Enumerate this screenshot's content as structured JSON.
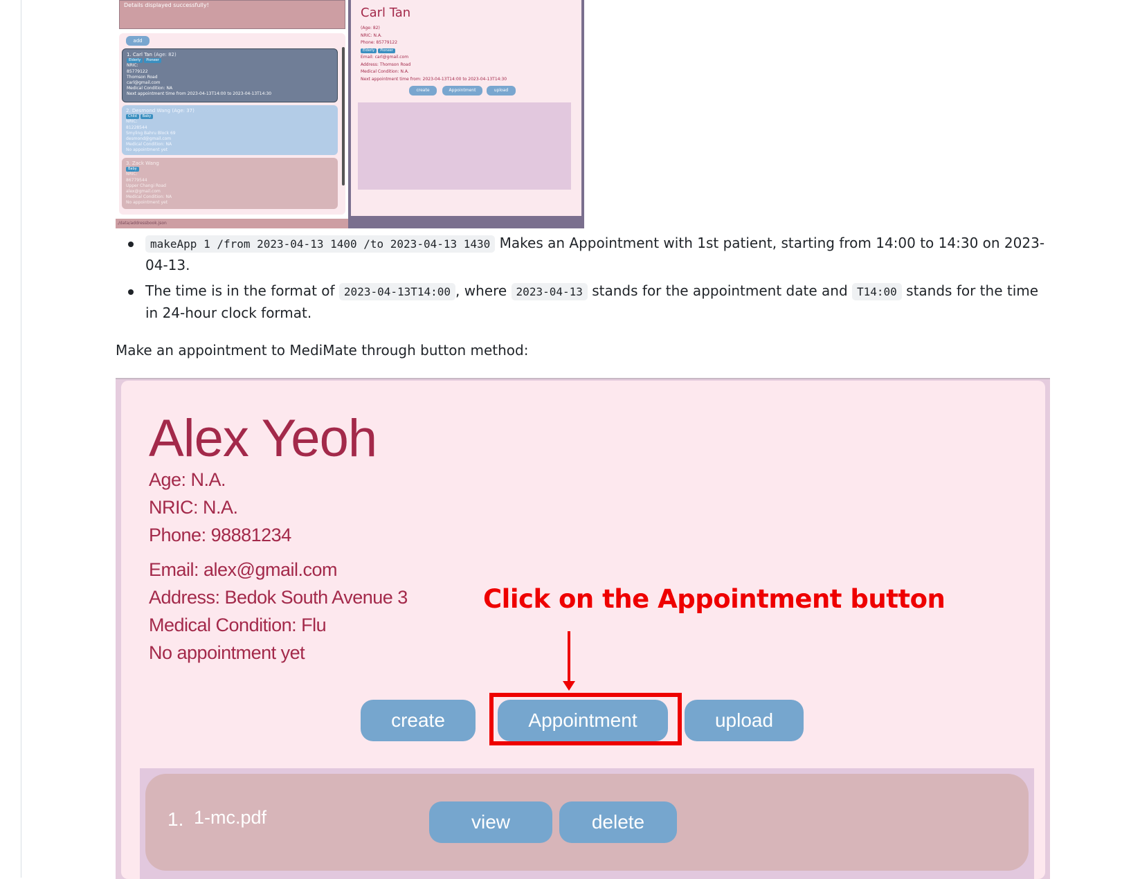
{
  "top_screenshot": {
    "result_text": "Details displayed successfully!",
    "add_label": "add",
    "cards": [
      {
        "index": "1.",
        "name": "Carl Tan",
        "age": "(Age: 82)",
        "tags": [
          "Elderly",
          "Pioneer"
        ],
        "lines": [
          "NRIC:",
          "85779122",
          "Thomson Road",
          "carl@gmail.com",
          "Medical Condition: NA",
          "Next appointment time from 2023-04-13T14:00 to 2023-04-13T14:30"
        ]
      },
      {
        "index": "2.",
        "name": "Desmond Wang",
        "age": "(Age: 37)",
        "tags": [
          "Child",
          "Baby"
        ],
        "lines": [
          "NRIC:",
          "81228544",
          "Smyling Bahru Block 69",
          "desmond@gmail.com",
          "Medical Condition: NA",
          "No appointment yet"
        ]
      },
      {
        "index": "3.",
        "name": "Zack Wang",
        "age": "",
        "tags": [
          "Baby"
        ],
        "lines": [
          "NRIC:",
          "86779544",
          "Upper Changi Road",
          "alex@gmail.com",
          "Medical Condition: NA",
          "No appointment yet"
        ]
      }
    ],
    "status_bar": "./data/addressbook.json",
    "detail": {
      "name": "Carl Tan",
      "age": "(Age: 82)",
      "nric": "NRIC: N.A.",
      "phone": "Phone: 85779122",
      "tags": [
        "Elderly",
        "Pioneer"
      ],
      "email": "Email: carl@gmail.com",
      "address": "Address: Thomson Road",
      "medical": "Medical Condition: N.A.",
      "appointment": "Next appointment time from: 2023-04-13T14:00 to 2023-04-13T14:30",
      "buttons": [
        "create",
        "Appointment",
        "upload"
      ]
    }
  },
  "bullets": [
    {
      "code": "makeApp 1 /from 2023-04-13 1400 /to 2023-04-13 1430",
      "text": " Makes an Appointment with 1st patient, starting from 14:00 to 14:30 on 2023-04-13."
    },
    {
      "text_a": "The time is in the format of ",
      "code_a": "2023-04-13T14:00",
      "text_b": ", where ",
      "code_b": "2023-04-13",
      "text_c": " stands for the appointment date and ",
      "code_c": "T14:00",
      "text_d": " stands for the time in 24-hour clock format."
    }
  ],
  "paragraph": "Make an appointment to MediMate through button method:",
  "main_screenshot": {
    "name": "Alex Yeoh",
    "age": "Age: N.A.",
    "nric": "NRIC: N.A.",
    "phone": "Phone: 98881234",
    "email": "Email: alex@gmail.com",
    "address": "Address: Bedok South Avenue 3",
    "medical": "Medical Condition: Flu",
    "appointment": "No appointment yet",
    "callout": "Click on the Appointment button",
    "buttons": {
      "create": "create",
      "appointment": "Appointment",
      "upload": "upload"
    },
    "document": {
      "index": "1.",
      "name": "1-mc.pdf",
      "view": "view",
      "delete": "delete"
    },
    "colors": {
      "accent": "#a3294a",
      "button": "#76a6ce",
      "highlight": "#ee0000",
      "panel": "#fde8ee"
    }
  }
}
